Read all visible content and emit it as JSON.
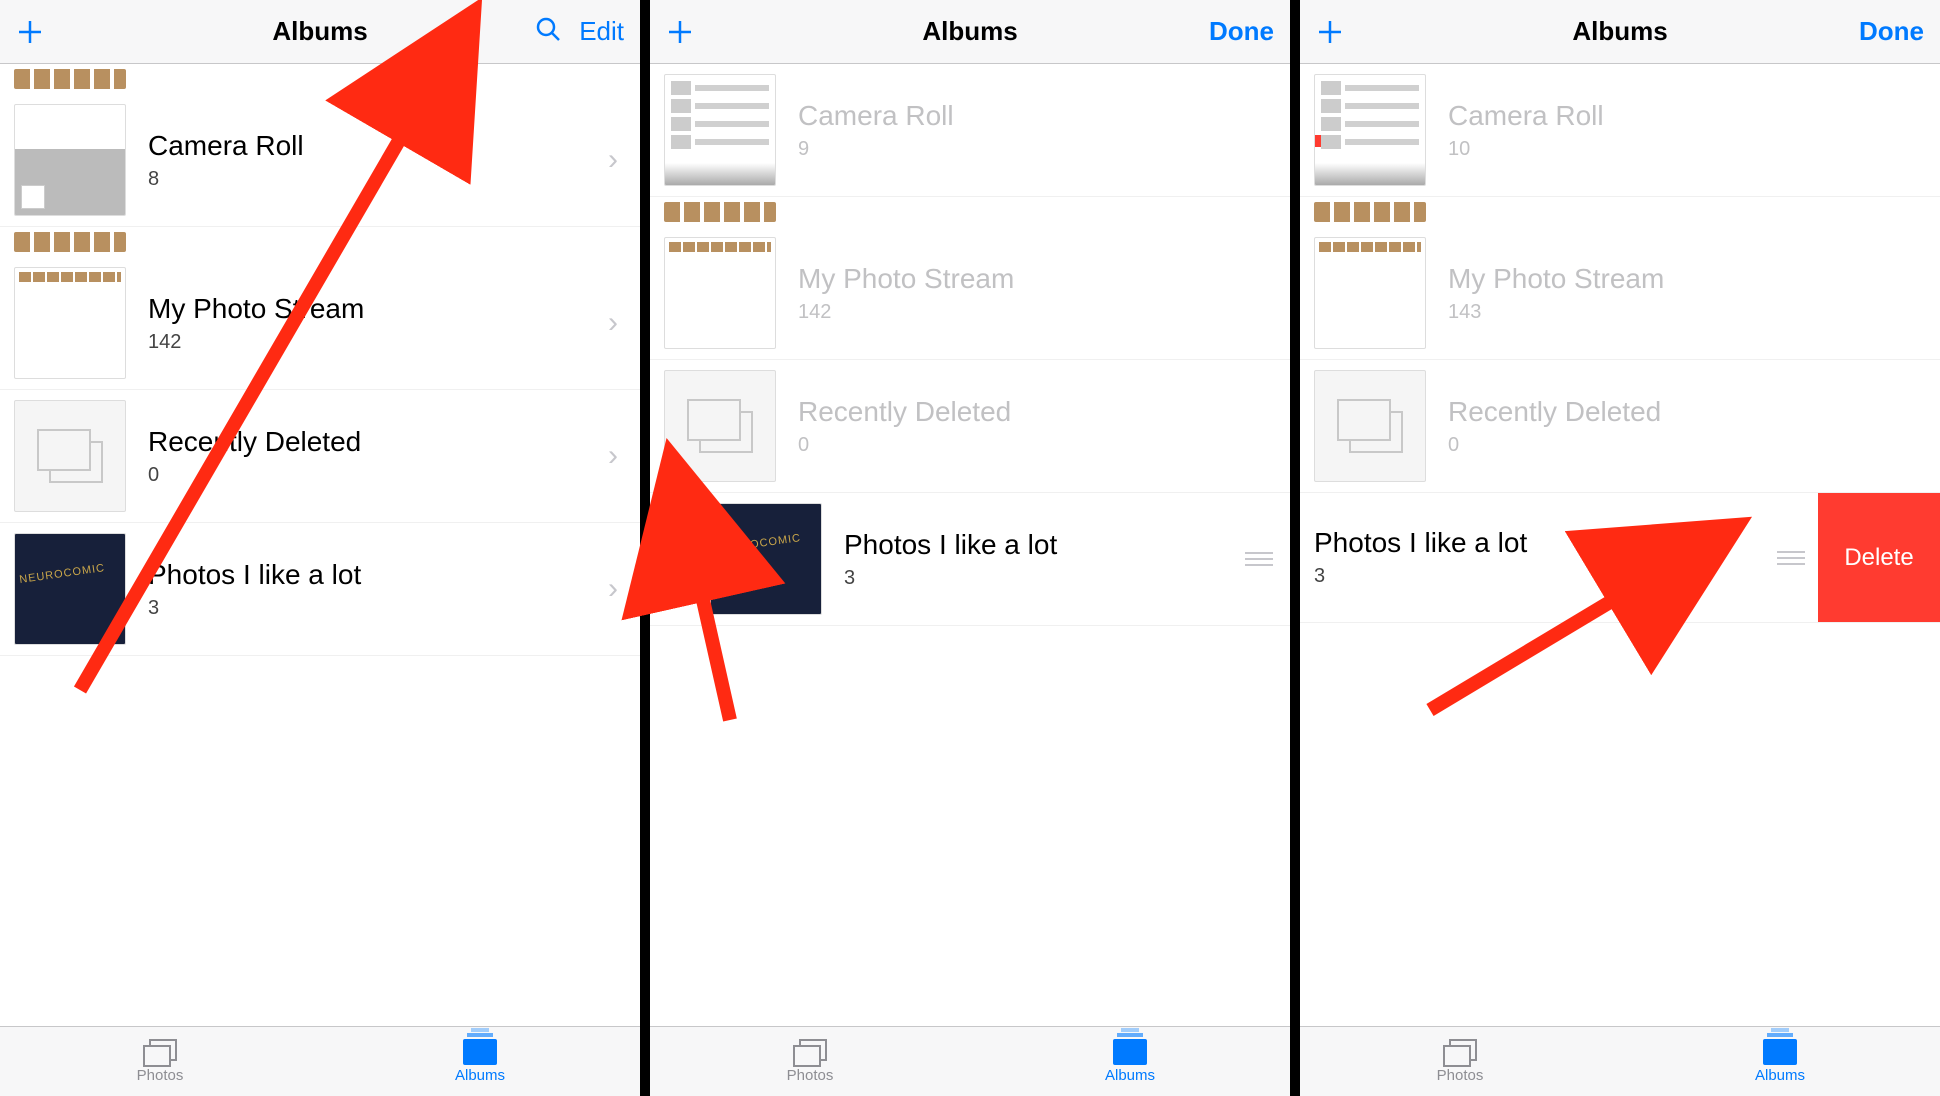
{
  "panels": [
    {
      "nav": {
        "title": "Albums",
        "right_action": "Edit",
        "show_search": true
      },
      "albums": [
        {
          "name": "Camera Roll",
          "count": "8"
        },
        {
          "name": "My Photo Stream",
          "count": "142"
        },
        {
          "name": "Recently Deleted",
          "count": "0"
        },
        {
          "name": "Photos I like a lot",
          "count": "3"
        }
      ],
      "tabs": {
        "photos": "Photos",
        "albums": "Albums"
      }
    },
    {
      "nav": {
        "title": "Albums",
        "right_action": "Done",
        "show_search": false
      },
      "albums": [
        {
          "name": "Camera Roll",
          "count": "9"
        },
        {
          "name": "My Photo Stream",
          "count": "142"
        },
        {
          "name": "Recently Deleted",
          "count": "0"
        },
        {
          "name": "Photos I like a lot",
          "count": "3"
        }
      ],
      "tabs": {
        "photos": "Photos",
        "albums": "Albums"
      }
    },
    {
      "nav": {
        "title": "Albums",
        "right_action": "Done",
        "show_search": false
      },
      "albums": [
        {
          "name": "Camera Roll",
          "count": "10"
        },
        {
          "name": "My Photo Stream",
          "count": "143"
        },
        {
          "name": "Recently Deleted",
          "count": "0"
        },
        {
          "name": "Photos I like a lot",
          "count": "3"
        }
      ],
      "delete_label": "Delete",
      "tabs": {
        "photos": "Photos",
        "albums": "Albums"
      }
    }
  ]
}
